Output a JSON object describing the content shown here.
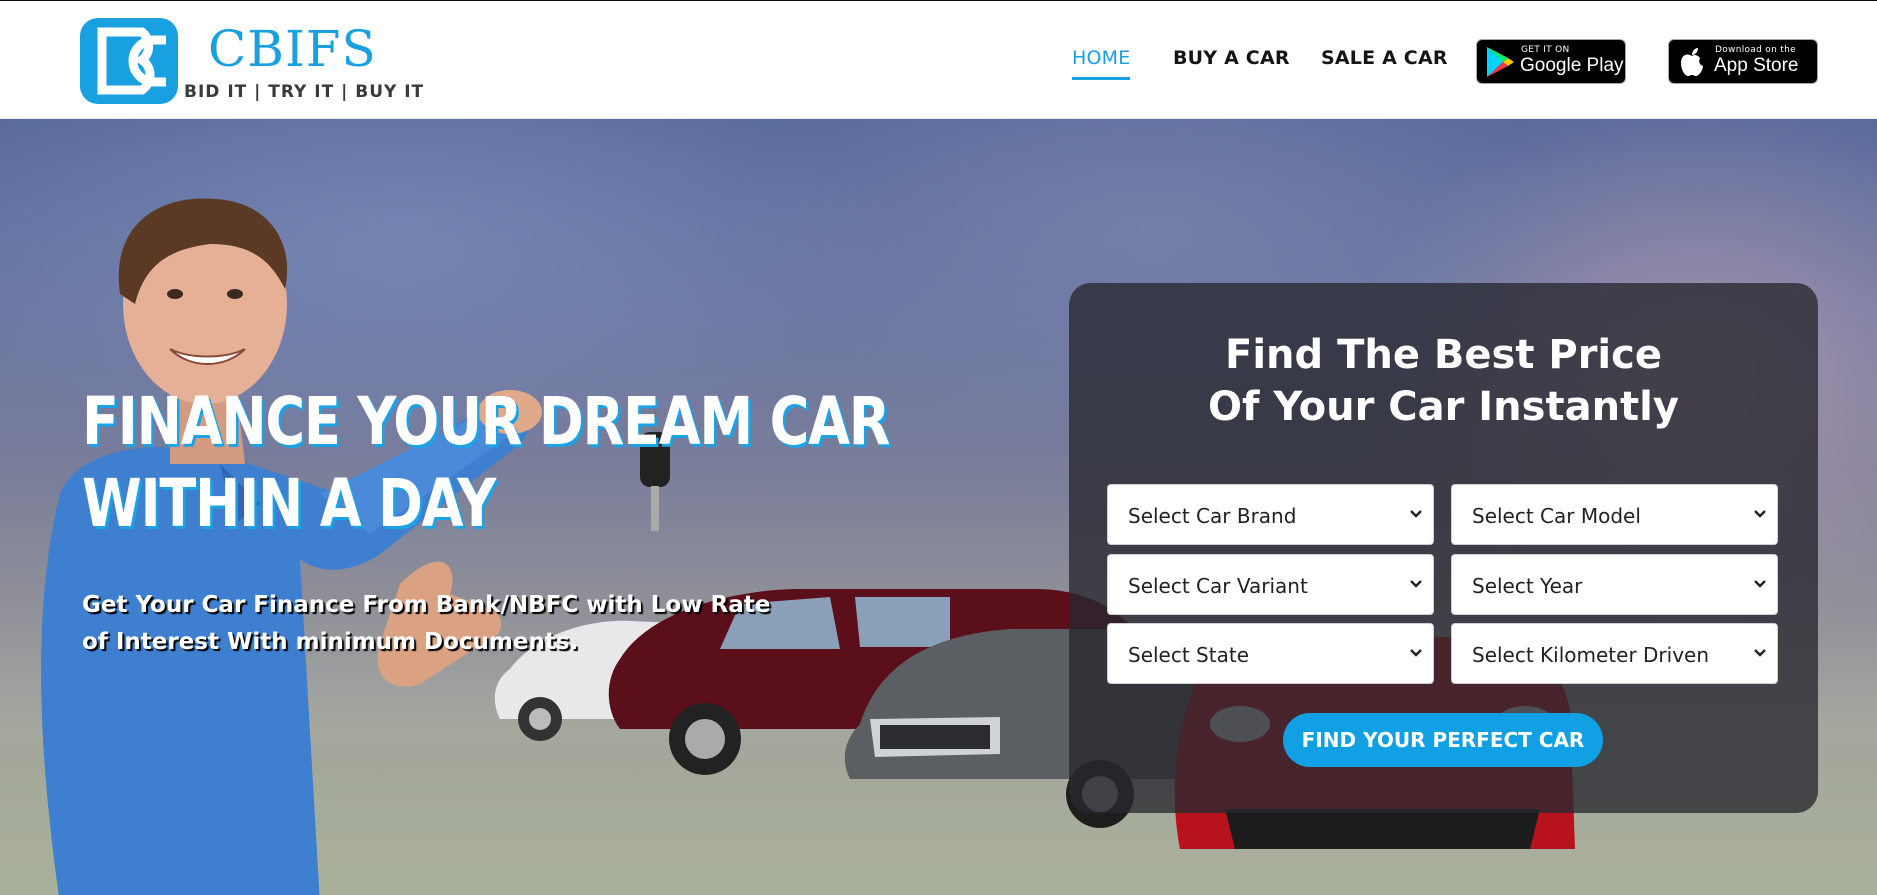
{
  "brand": {
    "name": "CBIFS",
    "tagline": "BID IT | TRY IT | BUY IT",
    "accent_color": "#18a0e0"
  },
  "nav": {
    "home": "HOME",
    "buy": "BUY A CAR",
    "sale": "SALE A CAR",
    "active": "HOME"
  },
  "badges": {
    "google_small": "GET IT ON",
    "google_big": "Google Play",
    "apple_small": "Download on the",
    "apple_big": "App Store"
  },
  "hero": {
    "title_line1": "FINANCE YOUR DREAM CAR",
    "title_line2": "WITHIN A DAY",
    "subtitle": "Get Your Car Finance From Bank/NBFC with Low Rate of Interest With minimum Documents."
  },
  "search": {
    "title_line1": "Find The Best Price",
    "title_line2": "Of Your Car Instantly",
    "selects": {
      "brand": "Select Car Brand",
      "model": "Select Car Model",
      "variant": "Select Car Variant",
      "year": "Select Year",
      "state": "Select State",
      "km": "Select Kilometer Driven"
    },
    "button": "FIND YOUR PERFECT CAR"
  }
}
